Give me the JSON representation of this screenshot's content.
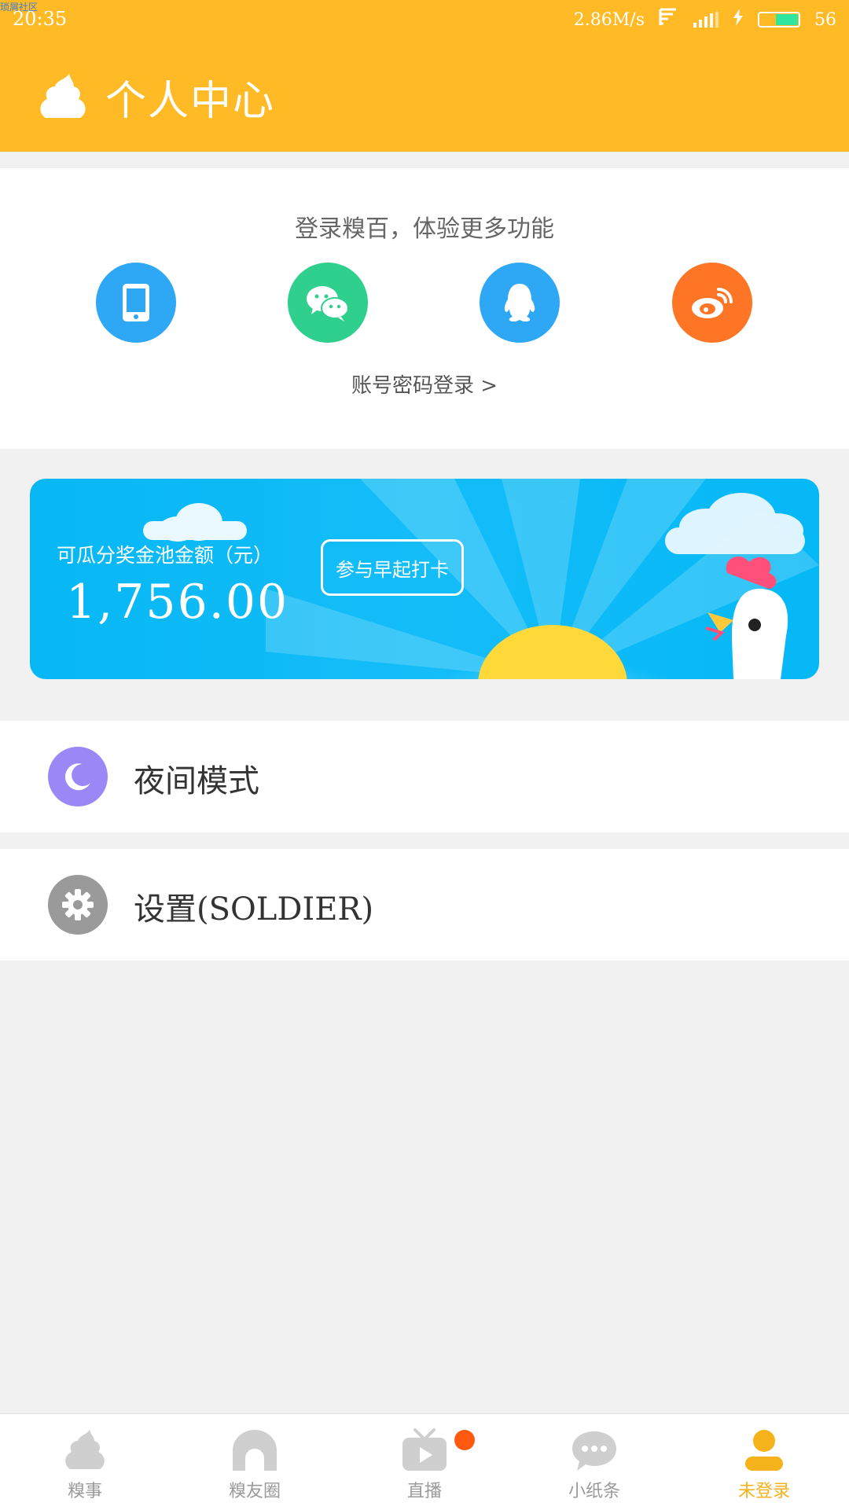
{
  "watermark": "琐屑社区",
  "status_bar": {
    "time": "20:35",
    "net_speed": "2.86M/s",
    "battery": "56"
  },
  "header": {
    "title": "个人中心"
  },
  "login": {
    "prompt": "登录糗百，体验更多功能",
    "account_login": "账号密码登录 >",
    "methods": [
      {
        "name": "phone",
        "color": "#2ea8f5"
      },
      {
        "name": "wechat",
        "color": "#2fcf8e"
      },
      {
        "name": "qq",
        "color": "#2ea8f5"
      },
      {
        "name": "weibo",
        "color": "#ff7526"
      }
    ]
  },
  "banner": {
    "label": "可瓜分奖金池金额（元）",
    "amount": "1,756.00",
    "button": "参与早起打卡"
  },
  "menu": {
    "night_mode": "夜间模式",
    "settings": "设置(SOLDIER)"
  },
  "tabs": [
    {
      "label": "糗事"
    },
    {
      "label": "糗友圈"
    },
    {
      "label": "直播"
    },
    {
      "label": "小纸条"
    },
    {
      "label": "未登录"
    }
  ],
  "colors": {
    "header": "#ffba25",
    "night_icon": "#9b87f5",
    "settings_icon": "#9a9a9a",
    "active_tab": "#f5b21a",
    "badge": "#ff5a10"
  }
}
